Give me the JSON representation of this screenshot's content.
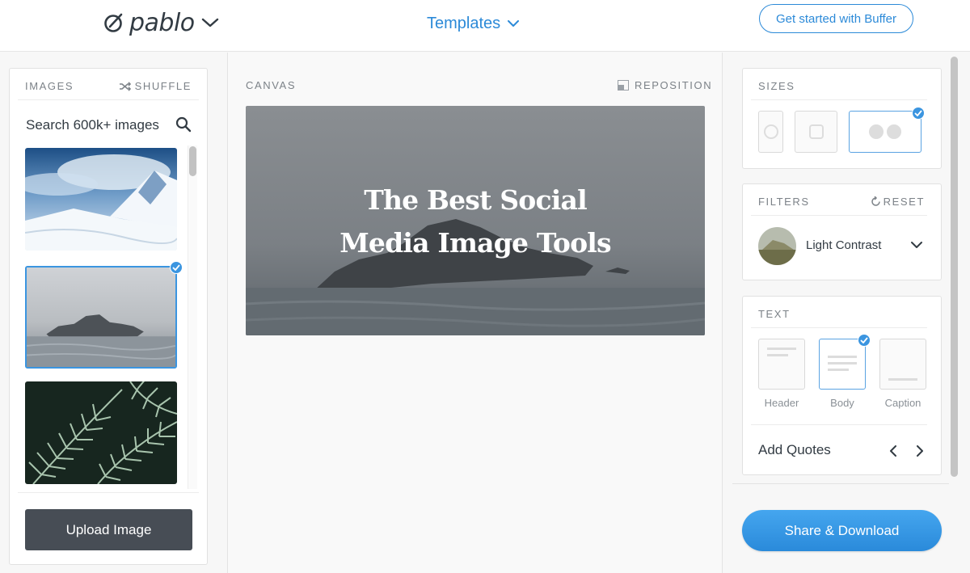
{
  "header": {
    "logo_text": "pablo",
    "templates_label": "Templates",
    "cta_label": "Get started with Buffer"
  },
  "images": {
    "title": "IMAGES",
    "shuffle_label": "SHUFFLE",
    "search_placeholder": "Search 600k+ images",
    "upload_label": "Upload Image",
    "thumbnails": [
      {
        "icon": "snowy-mountain-image",
        "selected": false
      },
      {
        "icon": "foggy-rocks-sea-image",
        "selected": true
      },
      {
        "icon": "fern-leaves-image",
        "selected": false
      }
    ]
  },
  "canvas": {
    "title": "CANVAS",
    "reposition_label": "REPOSITION",
    "headline_line1": "The Best Social",
    "headline_line2": "Media Image Tools"
  },
  "sizes": {
    "title": "SIZES",
    "options": [
      {
        "icon": "pinterest-icon",
        "selected": false
      },
      {
        "icon": "instagram-icon",
        "selected": false
      },
      {
        "icon": "facebook-twitter-icon",
        "selected": true
      }
    ]
  },
  "filters": {
    "title": "FILTERS",
    "reset_label": "RESET",
    "selected_filter": "Light Contrast"
  },
  "text": {
    "title": "TEXT",
    "options": [
      {
        "label": "Header",
        "selected": false
      },
      {
        "label": "Body",
        "selected": true
      },
      {
        "label": "Caption",
        "selected": false
      }
    ],
    "add_quotes_label": "Add Quotes"
  },
  "share_label": "Share & Download",
  "colors": {
    "accent": "#2c8ad8",
    "dark_button": "#474d55",
    "text": "#323b43"
  }
}
